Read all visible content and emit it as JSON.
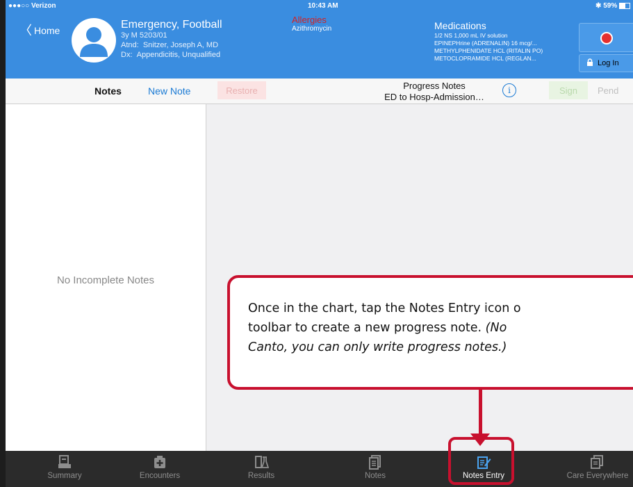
{
  "status_bar": {
    "carrier": "●●●○○ Verizon",
    "time": "10:43 AM",
    "battery": "59%"
  },
  "header": {
    "home_label": "Home",
    "patient_name": "Emergency, Football",
    "patient_info": "3y M  5203/01",
    "attending_label": "Atnd:",
    "attending": "Snitzer, Joseph A, MD",
    "dx_label": "Dx:",
    "dx": "Appendicitis, Unqualified",
    "allergies_heading": "Allergies",
    "allergies": "Azithromycin",
    "medications_heading": "Medications",
    "medications": [
      "1/2 NS 1,000 mL IV solution",
      "EPINEPHrine (ADRENALIN) 16 mcg/...",
      "METHYLPHENIDATE HCL (RITALIN PO)",
      "METOCLOPRAMIDE HCL (REGLAN..."
    ],
    "login_label": "Log In"
  },
  "toolbar": {
    "notes_label": "Notes",
    "new_note_label": "New Note",
    "restore_label": "Restore",
    "note_type": "Progress Notes",
    "note_context": "ED to Hosp-Admission…",
    "sign_label": "Sign",
    "pend_label": "Pend"
  },
  "left_pane": {
    "empty_message": "No Incomplete Notes"
  },
  "callout": {
    "line1": "Once in the chart, tap the Notes Entry icon o",
    "line2_plain": "toolbar to create a new progress note. ",
    "line2_italic": "(No",
    "line3_italic": "Canto, you can only write progress notes.)"
  },
  "tabs": [
    {
      "label": "Summary",
      "icon": "summary-icon",
      "active": false
    },
    {
      "label": "Encounters",
      "icon": "encounters-icon",
      "active": false
    },
    {
      "label": "Results",
      "icon": "results-icon",
      "active": false
    },
    {
      "label": "Notes",
      "icon": "notes-icon",
      "active": false
    },
    {
      "label": "Notes Entry",
      "icon": "notes-entry-icon",
      "active": true
    },
    {
      "label": "Care Everywhere",
      "icon": "care-everywhere-icon",
      "active": false
    }
  ],
  "colors": {
    "header_blue": "#3a8de0",
    "callout_red": "#c8102e",
    "active_tab": "#4aa3f0"
  }
}
